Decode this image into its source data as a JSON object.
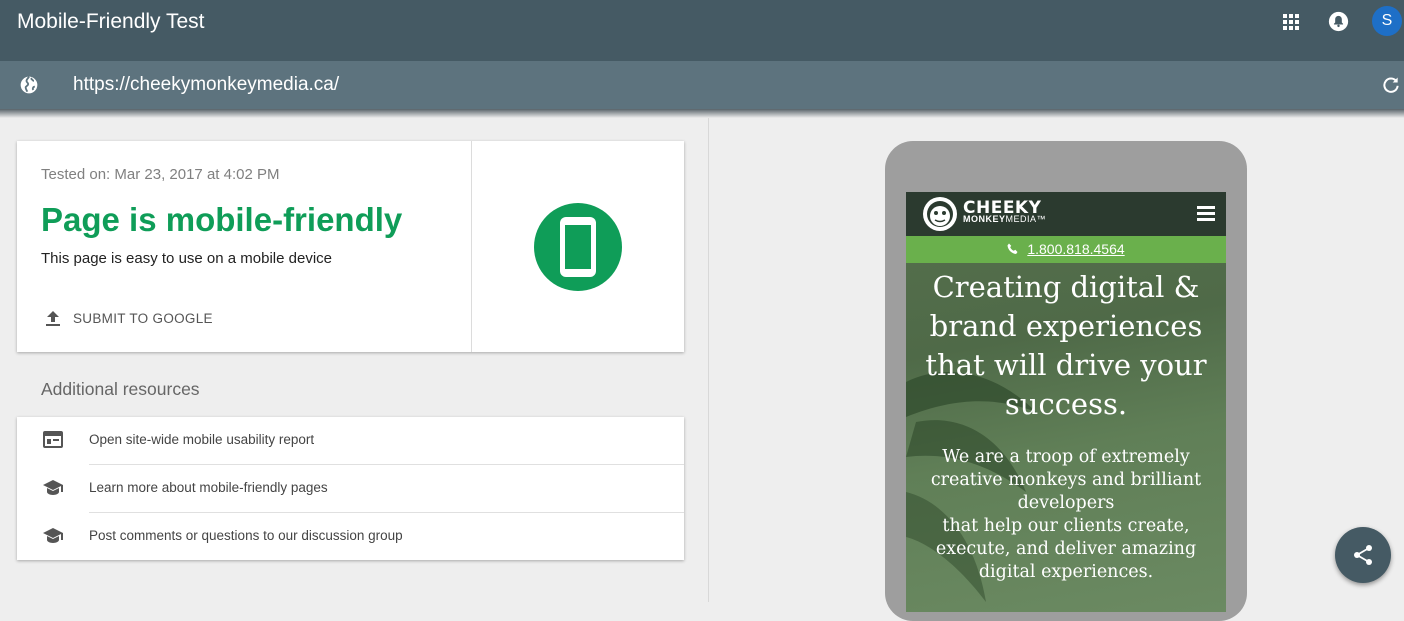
{
  "app": {
    "title": "Mobile-Friendly Test",
    "avatar_initial": "S"
  },
  "topbar_icons": [
    "apps-grid-icon",
    "notifications-icon",
    "account-avatar"
  ],
  "url_bar": {
    "value": "https://cheekymonkeymedia.ca/",
    "icons": [
      "globe-icon",
      "reload-icon"
    ]
  },
  "result": {
    "tested_on": "Tested on: Mar 23, 2017 at 4:02 PM",
    "verdict": "Page is mobile-friendly",
    "description": "This page is easy to use on a mobile device",
    "submit_label": "SUBMIT TO GOOGLE",
    "status_color": "#0f9d58"
  },
  "resources": {
    "heading": "Additional resources",
    "items": [
      {
        "label": "Open site-wide mobile usability report",
        "icon": "report-icon"
      },
      {
        "label": "Learn more about mobile-friendly pages",
        "icon": "school-icon"
      },
      {
        "label": "Post comments or questions to our discussion group",
        "icon": "school-icon"
      }
    ]
  },
  "preview": {
    "logo_line1": "CHEEKY",
    "logo_line2_bold": "MONKEY",
    "logo_line2_light": "MEDIA",
    "logo_tm": "™",
    "phone_number": "1.800.818.4564",
    "hero_title": "Creating digital & brand experiences that will drive your success.",
    "hero_body_1": "We are a troop of extremely creative monkeys and brilliant developers",
    "hero_body_2": "that help our clients create, execute, and deliver amazing digital experiences.",
    "strip_color": "#6ab04c"
  },
  "colors": {
    "topbar": "#455a64",
    "urlbar": "#5d737e",
    "accent_green": "#0f9d58"
  }
}
